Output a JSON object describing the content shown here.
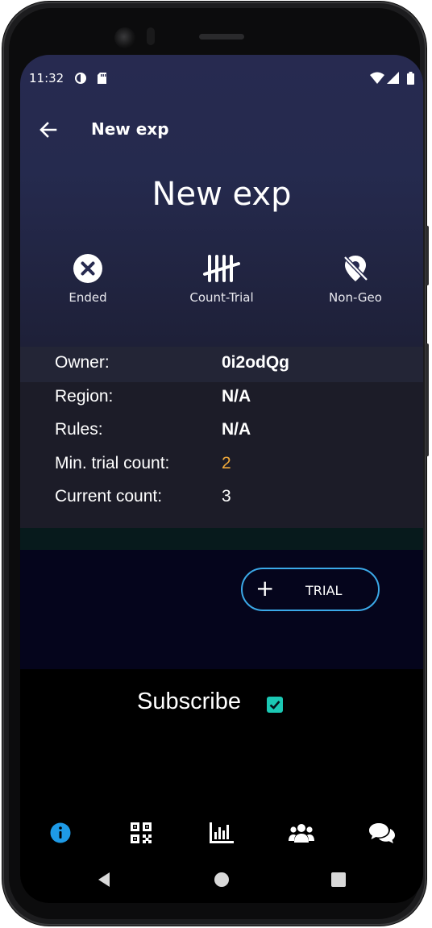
{
  "status_bar": {
    "time": "11:32"
  },
  "app_bar": {
    "title": "New exp"
  },
  "experiment": {
    "heading": "New exp",
    "badges": [
      {
        "label": "Ended",
        "icon": "close-circle-icon"
      },
      {
        "label": "Count-Trial",
        "icon": "tally-icon"
      },
      {
        "label": "Non-Geo",
        "icon": "location-off-icon"
      }
    ]
  },
  "details": [
    {
      "key": "Owner:",
      "value": "0i2odQg"
    },
    {
      "key": "Region:",
      "value": "N/A"
    },
    {
      "key": "Rules:",
      "value": "N/A"
    },
    {
      "key": "Min. trial count:",
      "value": "2"
    },
    {
      "key": "Current count:",
      "value": "3"
    }
  ],
  "actions": {
    "trial_label": "TRIAL",
    "trial_icon": "plus-icon"
  },
  "subscribe": {
    "label": "Subscribe",
    "checked": true
  },
  "bottom_nav": [
    "info-icon",
    "qr-code-icon",
    "bar-chart-icon",
    "users-icon",
    "chat-icon"
  ],
  "colors": {
    "accent": "#1e9ae6",
    "highlight_value": "#f0a93a",
    "checkbox": "#1bc8b4",
    "button_border": "#3ba9e8"
  }
}
